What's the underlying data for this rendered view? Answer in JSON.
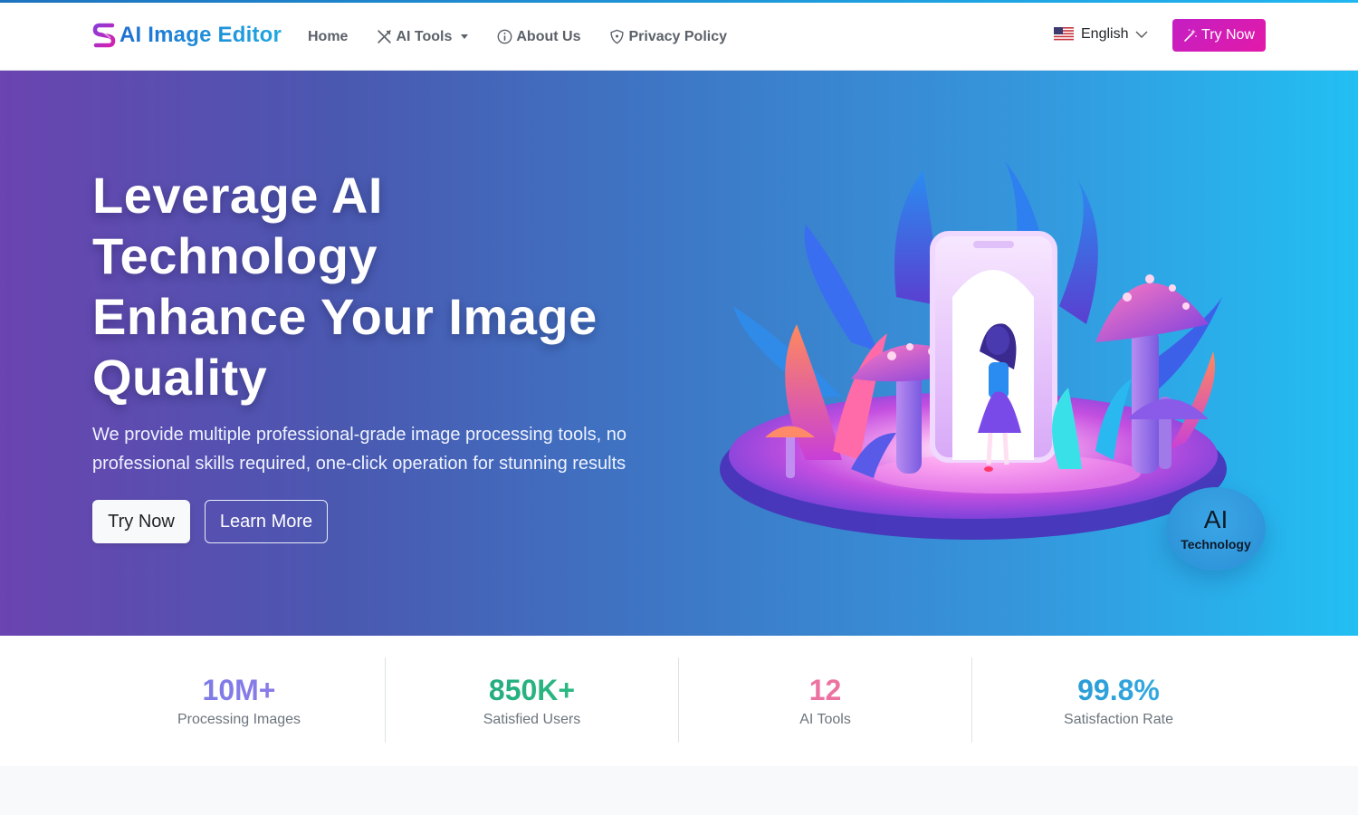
{
  "brand": {
    "name": "AI Image Editor"
  },
  "nav": {
    "items": [
      {
        "label": "Home",
        "icon": ""
      },
      {
        "label": "AI Tools",
        "icon": "tools-icon"
      },
      {
        "label": "About Us",
        "icon": "info-circle-icon"
      },
      {
        "label": "Privacy Policy",
        "icon": "shield-icon"
      }
    ],
    "language": "English",
    "cta_label": "Try Now"
  },
  "hero": {
    "title_lines": [
      "Leverage AI",
      "Technology",
      "Enhance Your Image",
      "Quality"
    ],
    "subtitle": "We provide multiple professional-grade image processing tools, no professional skills required, one-click operation for stunning results",
    "primary_button": "Try Now",
    "secondary_button": "Learn More",
    "badge_big": "AI",
    "badge_small": "Technology"
  },
  "stats": [
    {
      "value": "10M+",
      "label": "Processing Images"
    },
    {
      "value": "850K+",
      "label": "Satisfied Users"
    },
    {
      "value": "12",
      "label": "AI Tools"
    },
    {
      "value": "99.8%",
      "label": "Satisfaction Rate"
    }
  ],
  "colors": {
    "brand_blue": "#1e6fd1",
    "cta_magenta": "#d21fb8",
    "hero_start": "#6a44b0",
    "hero_end": "#22bff3"
  }
}
